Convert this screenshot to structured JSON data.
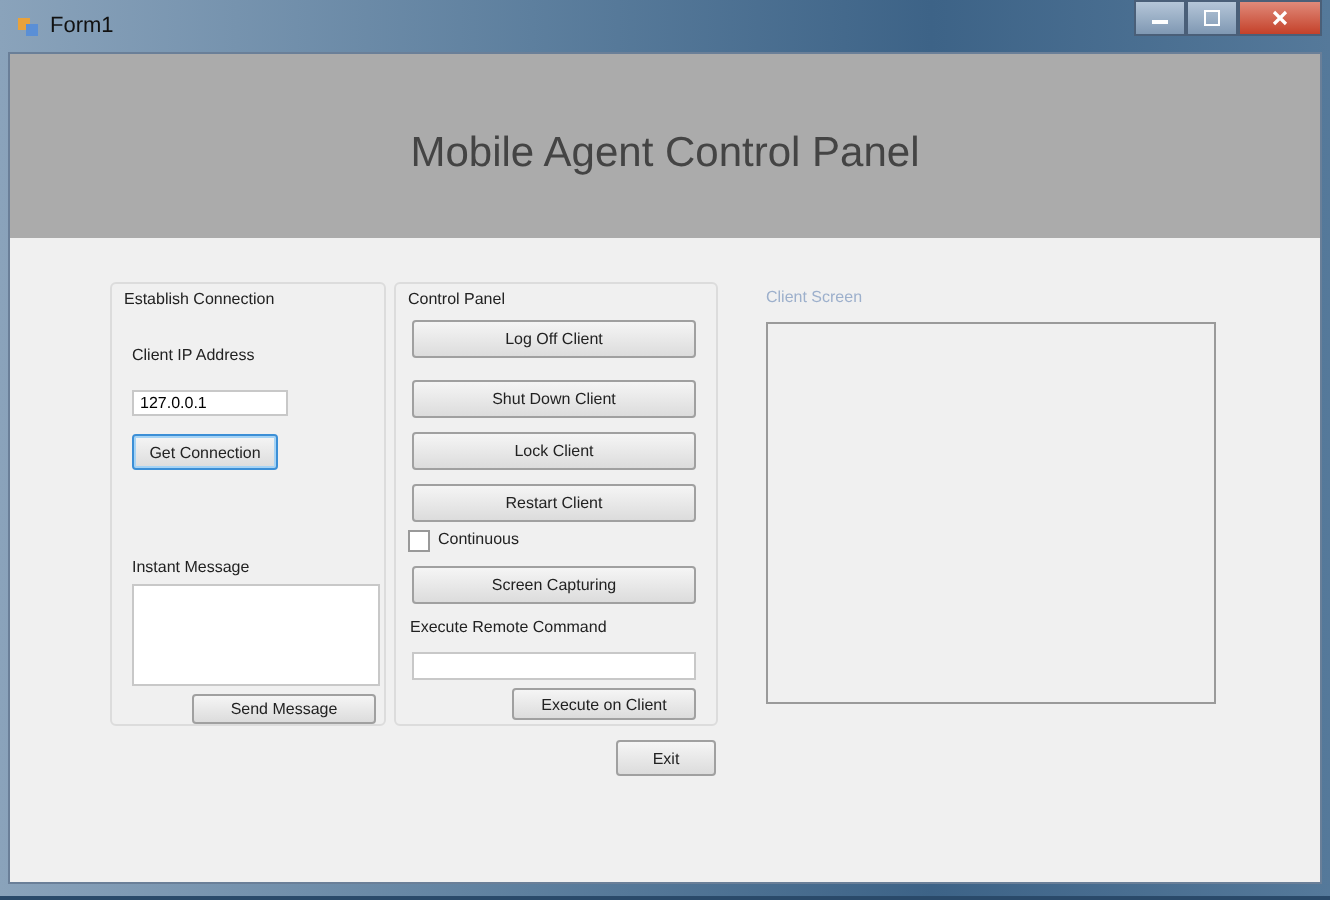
{
  "window": {
    "title": "Form1"
  },
  "header": {
    "title": "Mobile Agent Control Panel"
  },
  "establish_connection": {
    "title": "Establish Connection",
    "ip_label": "Client IP Address",
    "ip_value": "127.0.0.1",
    "connect_button": "Get Connection",
    "message_label": "Instant Message",
    "send_button": "Send Message"
  },
  "control_panel": {
    "title": "Control Panel",
    "buttons": [
      "Log Off Client",
      "Shut Down Client",
      "Lock Client",
      "Restart Client"
    ],
    "continuous": {
      "label": "Continuous",
      "checked": false
    },
    "capture_button": "Screen Capturing",
    "command_label": "Execute Remote Command",
    "execute_button": "Execute on Client"
  },
  "client_screen": {
    "title": "Client Screen",
    "disabled": true
  },
  "exit_button": "Exit"
}
